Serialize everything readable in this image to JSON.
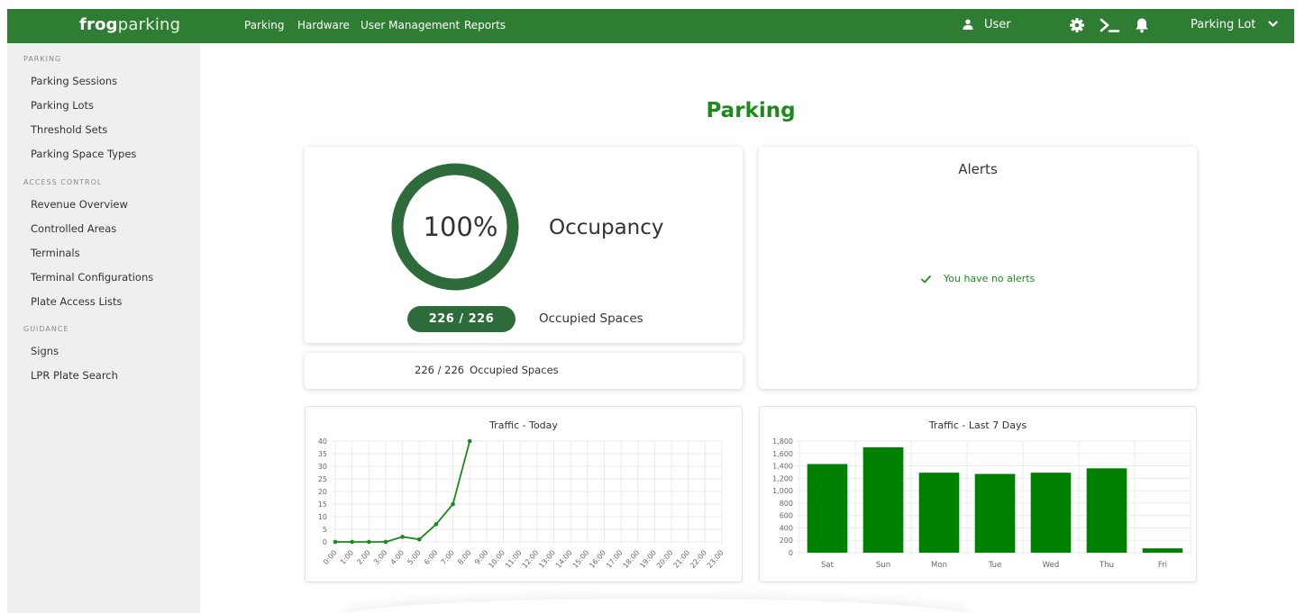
{
  "header": {
    "brand_bold": "frog",
    "brand_light": "parking",
    "nav": [
      "Parking",
      "Hardware",
      "User Management",
      "Reports"
    ],
    "user_label": "User",
    "icons": [
      "user-icon",
      "gear-icon",
      "terminal-icon",
      "bell-icon",
      "chevron-down-icon"
    ],
    "lot_selector": "Parking Lot"
  },
  "sidebar": {
    "sections": [
      {
        "title": "PARKING",
        "items": [
          "Parking Sessions",
          "Parking Lots",
          "Threshold Sets",
          "Parking Space Types"
        ]
      },
      {
        "title": "ACCESS CONTROL",
        "items": [
          "Revenue Overview",
          "Controlled Areas",
          "Terminals",
          "Terminal Configurations",
          "Plate Access Lists"
        ]
      },
      {
        "title": "GUIDANCE",
        "items": [
          "Signs",
          "LPR Plate Search"
        ]
      }
    ]
  },
  "page": {
    "title": "Parking"
  },
  "occupancy": {
    "percent_label": "100%",
    "percent_value": 100,
    "label": "Occupancy",
    "pill": "226 / 226",
    "spaces_label": "Occupied Spaces",
    "strip_count": "226 / 226",
    "strip_label": "Occupied Spaces"
  },
  "alerts": {
    "title": "Alerts",
    "message": "You have no alerts"
  },
  "colors": {
    "brand": "#2e7d32",
    "accent_text": "#1e8a1e",
    "ring": "#2e6b3a",
    "chart_line": "#1a8a1a",
    "bar": "#008000"
  },
  "chart_data": [
    {
      "type": "line",
      "title": "Traffic - Today",
      "x": [
        "0:00",
        "1:00",
        "2:00",
        "3:00",
        "4:00",
        "5:00",
        "6:00",
        "7:00",
        "8:00",
        "9:00",
        "10:00",
        "11:00",
        "12:00",
        "13:00",
        "14:00",
        "15:00",
        "16:00",
        "17:00",
        "18:00",
        "19:00",
        "20:00",
        "21:00",
        "22:00",
        "23:00"
      ],
      "values": [
        0,
        0,
        0,
        0,
        2,
        1,
        7,
        15,
        40
      ],
      "yticks": [
        0,
        5,
        10,
        15,
        20,
        25,
        30,
        35,
        40
      ],
      "ylim": [
        0,
        40
      ],
      "grid": true
    },
    {
      "type": "bar",
      "title": "Traffic - Last 7 Days",
      "categories": [
        "Sat",
        "Sun",
        "Mon",
        "Tue",
        "Wed",
        "Thu",
        "Fri"
      ],
      "values": [
        1430,
        1700,
        1290,
        1270,
        1290,
        1360,
        70
      ],
      "yticks": [
        0,
        200,
        400,
        600,
        800,
        1000,
        1200,
        1400,
        1600,
        1800
      ],
      "ytick_labels": [
        "0",
        "200",
        "400",
        "600",
        "800",
        "1,000",
        "1,200",
        "1,400",
        "1,600",
        "1,800"
      ],
      "ylim": [
        0,
        1800
      ],
      "grid": true
    }
  ]
}
